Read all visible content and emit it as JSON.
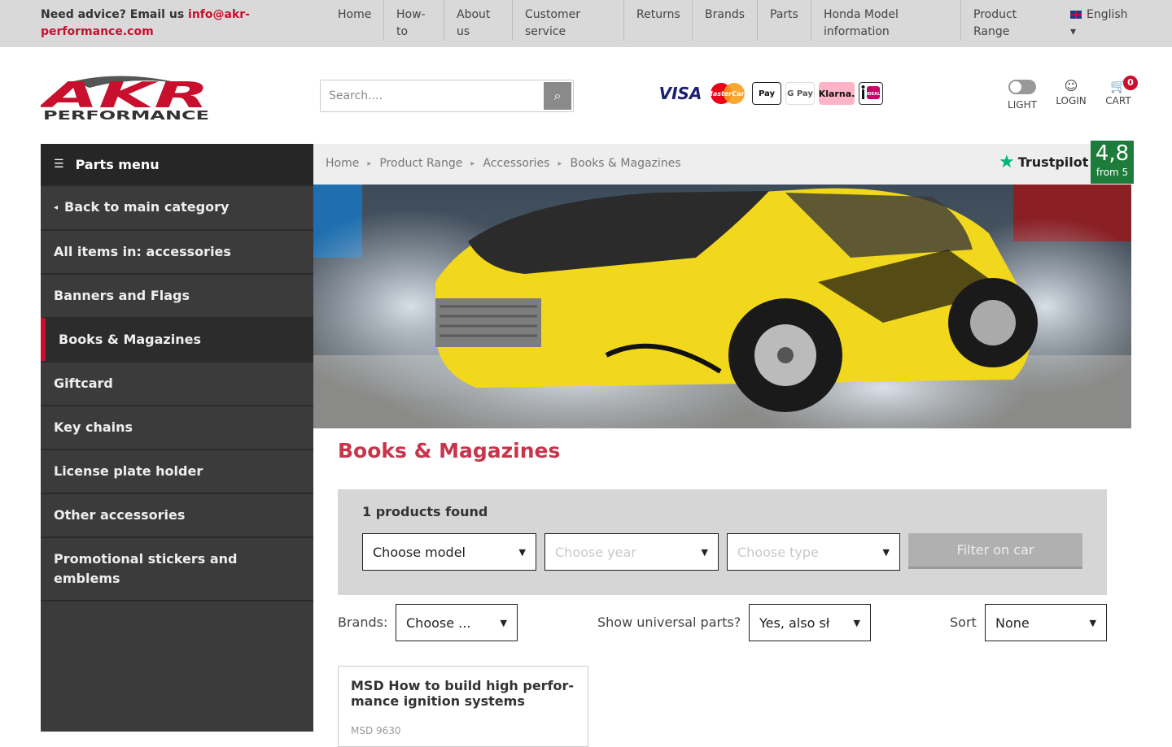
{
  "topbar": {
    "advice_prefix": "Need advice? Email us ",
    "advice_email": "info@akr-performance.com",
    "nav": [
      "Home",
      "How-to",
      "About us",
      "Customer service",
      "Returns",
      "Brands",
      "Parts",
      "Honda Model information",
      "Product Range"
    ],
    "language": "English",
    "language_caret": "▾"
  },
  "header": {
    "logo_text": "AKR",
    "logo_sub": "PERFORMANCE",
    "search_placeholder": "Search....",
    "search_icon": "⌕",
    "payments": {
      "visa": "VISA",
      "mastercard": "MasterCard",
      "applepay": " Pay",
      "gpay": "G Pay",
      "klarna": "Klarna.",
      "ideal": "iDEAL"
    },
    "theme_label": "LIGHT",
    "login_label": "LOGIN",
    "login_icon": "☺",
    "cart_label": "CART",
    "cart_icon": "🛒",
    "cart_count": "0"
  },
  "sidebar": {
    "title": "Parts menu",
    "title_icon": "☰",
    "items": [
      {
        "label": "Back to main category",
        "caret": "◂"
      },
      {
        "label": "All items in: accessories"
      },
      {
        "label": "Banners and Flags"
      },
      {
        "label": "Books & Magazines"
      },
      {
        "label": "Giftcard"
      },
      {
        "label": "Key chains"
      },
      {
        "label": "License plate holder"
      },
      {
        "label": "Other accessories"
      },
      {
        "label": "Promotional stickers and emblems"
      }
    ]
  },
  "breadcrumb": {
    "items": [
      "Home",
      "Product Range",
      "Accessories",
      "Books & Magazines"
    ],
    "sep": "▸"
  },
  "trustpilot": {
    "brand": "Trustpilot",
    "star": "★",
    "score": "4,8",
    "from": "from 5"
  },
  "main": {
    "title": "Books & Magazines",
    "found": "1 products found",
    "filters": {
      "model": "Choose model",
      "year": "Choose year",
      "type": "Choose type",
      "button": "Filter on car",
      "arrow": "▼"
    },
    "brands_label": "Brands:",
    "brands_value": "Choose ...",
    "universal_label": "Show universal parts?",
    "universal_value": "Yes, also sł",
    "sort_label": "Sort",
    "sort_value": "None"
  },
  "product": {
    "name": "MSD How to build high perfor-mance ignition systems",
    "sku": "MSD 9630"
  },
  "colors": {
    "brand_red": "#c8102e",
    "title_red": "#c8344a",
    "sidebar": "#3b3b3b",
    "trust_green": "#1e7c3a"
  }
}
